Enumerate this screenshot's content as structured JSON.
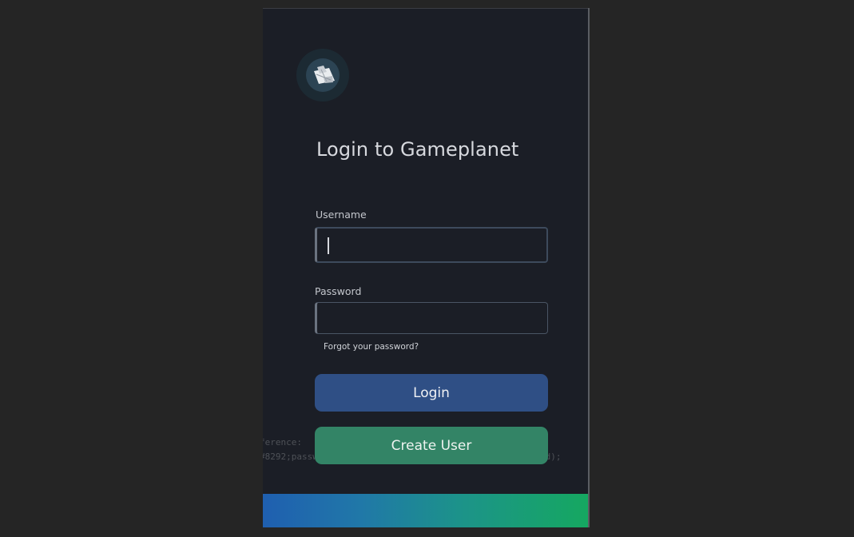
{
  "app": {
    "title": "Login to Gameplanet",
    "logo_icon": "spaceship-icon"
  },
  "form": {
    "username_label": "Username",
    "username_value": "",
    "password_label": "Password",
    "password_value": "",
    "forgot_link": "Forgot your password?"
  },
  "buttons": {
    "login_label": "Login",
    "create_label": "Create User"
  },
  "background_code": {
    "line1": "ference:",
    "line2": "#8292;password=(0)iallow_save; sandbox=false\", password);"
  },
  "colors": {
    "login_button": "#2f4f85",
    "create_button": "#338466",
    "bar_start": "#1f5fb0",
    "bar_end": "#15a860"
  }
}
